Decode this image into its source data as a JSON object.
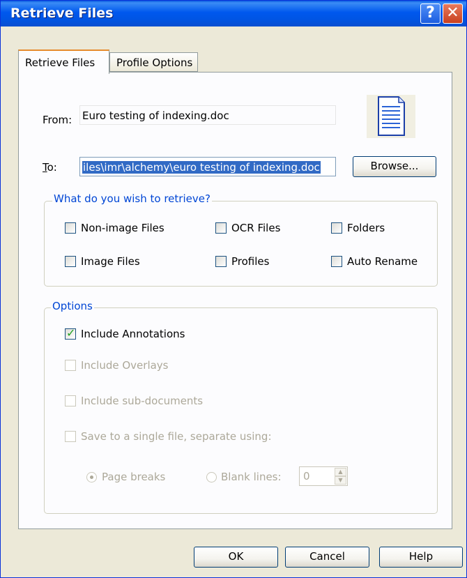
{
  "window": {
    "title": "Retrieve Files",
    "help_glyph": "?",
    "close_glyph": "✕"
  },
  "tabs": [
    {
      "label": "Retrieve Files",
      "active": true
    },
    {
      "label": "Profile Options",
      "active": false
    }
  ],
  "from": {
    "label": "From:",
    "value": "Euro testing of indexing.doc"
  },
  "to": {
    "label": "To:",
    "value": "iles\\imr\\alchemy\\euro testing of indexing.doc"
  },
  "browse_button": "Browse...",
  "doc_icon": "document-icon",
  "retrieve_group": {
    "title": "What do you wish to retrieve?",
    "options": [
      {
        "label": "Non-image Files",
        "checked": false
      },
      {
        "label": "OCR Files",
        "checked": false
      },
      {
        "label": "Folders",
        "checked": false
      },
      {
        "label": "Image Files",
        "checked": false
      },
      {
        "label": "Profiles",
        "checked": false
      },
      {
        "label": "Auto Rename",
        "checked": false
      }
    ]
  },
  "options_group": {
    "title": "Options",
    "include_annotations": {
      "label": "Include Annotations",
      "checked": true,
      "enabled": true
    },
    "include_overlays": {
      "label": "Include Overlays",
      "checked": false,
      "enabled": false
    },
    "include_subdocs": {
      "label": "Include sub-documents",
      "checked": false,
      "enabled": false
    },
    "save_single_file": {
      "label": "Save to a single file, separate using:",
      "checked": false,
      "enabled": false
    },
    "page_breaks": {
      "label": "Page breaks",
      "selected": true,
      "enabled": false
    },
    "blank_lines": {
      "label": "Blank lines:",
      "selected": false,
      "enabled": false,
      "value": "0"
    }
  },
  "buttons": {
    "ok": "OK",
    "cancel": "Cancel",
    "help": "Help"
  },
  "colors": {
    "title_bar": "#0058ee",
    "accent_tab": "#e68b2c",
    "group_title": "#0046d5",
    "checkmark": "#21a121"
  }
}
